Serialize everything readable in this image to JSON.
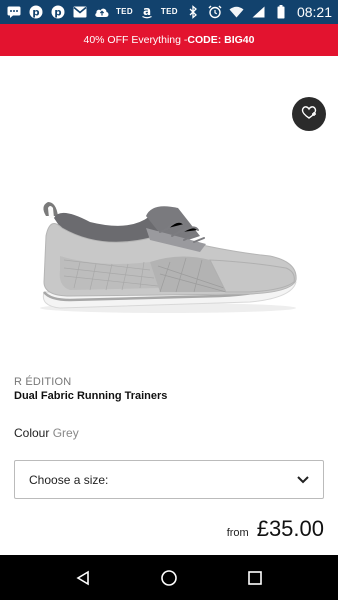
{
  "status_bar": {
    "left_icons": [
      "message-icon",
      "pinterest-icon",
      "pinterest-icon",
      "gmail-icon",
      "cloud-upload-icon"
    ],
    "ted_label_1": "TED",
    "ted_label_2": "TED",
    "amazon_glyph": "a",
    "right_icons": [
      "bluetooth-icon",
      "alarm-icon",
      "wifi-icon",
      "signal-icon",
      "battery-icon"
    ],
    "time": "08:21"
  },
  "promo": {
    "text": "40% OFF Everything - ",
    "code": "CODE: BIG40",
    "color": "#e3132f"
  },
  "product": {
    "brand": "R ÉDITION",
    "name": "Dual Fabric Running Trainers",
    "colour_label": "Colour",
    "colour_value": "Grey",
    "size_placeholder": "Choose a size:",
    "price_prefix": "from",
    "price": "£35.00"
  },
  "nav": {
    "icons": [
      "back-icon",
      "home-icon",
      "recents-icon"
    ]
  }
}
